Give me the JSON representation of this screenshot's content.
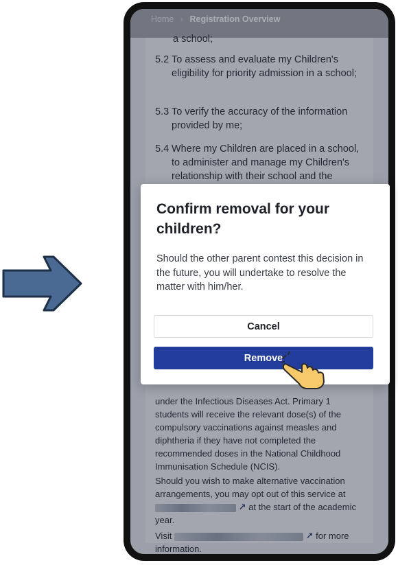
{
  "breadcrumb": {
    "home": "Home",
    "separator": "›",
    "current": "Registration Overview"
  },
  "document": {
    "cut_off_top": "a school;",
    "items": [
      {
        "num": "5.2",
        "text": "To assess and evaluate my Children's eligibility for priority admission in a school;"
      },
      {
        "num": "5.3",
        "text": "To verify the accuracy of the information provided by me;"
      },
      {
        "num": "5.4",
        "text": "Where my Children are placed in a school, to administer and manage my Children's relationship with their school and the Ministry of Education"
      }
    ],
    "vaccination_para": "under the Infectious Diseases Act. Primary 1 students will receive the relevant dose(s) of the compulsory vaccinations against measles and diphtheria if they have not completed the recommended doses in the National Childhood Immunisation Schedule (NCIS).",
    "opt_out_lead": "Should you wish to make alternative vaccination arrangements, you may opt out of this service at",
    "opt_out_tail": "at the start of the academic year.",
    "visit_lead": "Visit",
    "visit_tail": "for more information."
  },
  "modal": {
    "title": "Confirm removal for your children?",
    "body": "Should the other parent contest this decision in the future, you will undertake to resolve the matter with him/her.",
    "cancel_label": "Cancel",
    "remove_label": "Remove"
  },
  "icons": {
    "arrow": "right-arrow-icon",
    "pointer": "pointing-hand-icon",
    "external": "external-link-icon"
  },
  "colors": {
    "primary_button": "#233d9c",
    "arrow_fill": "#4a6a93",
    "hand": "#f7c96a"
  }
}
